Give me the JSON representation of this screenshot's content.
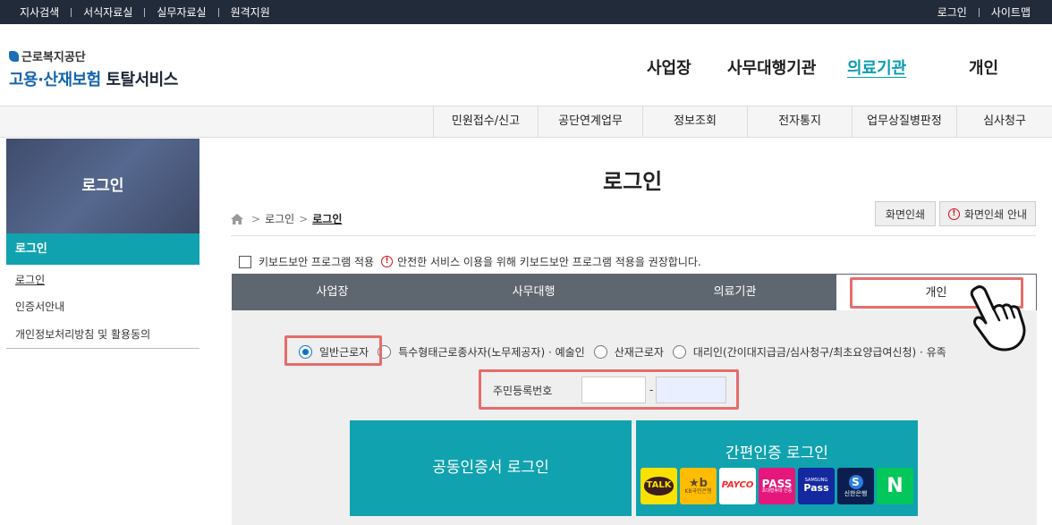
{
  "topbar": {
    "left_links": [
      "지사검색",
      "서식자료실",
      "실무자료실",
      "원격지원"
    ],
    "right_links": [
      "로그인",
      "사이트맵"
    ]
  },
  "logo": {
    "small_text": "근로복지공단",
    "big_blue": "고용·산재보험",
    "big_dark": "토탈서비스"
  },
  "gnb": [
    "사업장",
    "사무대행기관",
    "의료기관",
    "개인"
  ],
  "subnav": [
    "민원접수/신고",
    "공단연계업무",
    "정보조회",
    "전자통지",
    "업무상질병판정",
    "심사청구"
  ],
  "sidebar": {
    "title": "로그인",
    "section": "로그인",
    "items": [
      "로그인",
      "인증서안내",
      "개인정보처리방침 및 활용동의"
    ]
  },
  "content": {
    "title": "로그인",
    "breadcrumb": [
      "로그인",
      "로그인"
    ],
    "print_label": "화면인쇄",
    "print_guide_label": "화면인쇄 안내",
    "keyboard_security_label": "키보드보안 프로그램 적용",
    "keyboard_security_notice": "안전한 서비스 이용을 위해 키보드보안 프로그램 적용을 권장합니다.",
    "warn_glyph": "!"
  },
  "tabs": [
    "사업장",
    "사무대행",
    "의료기관",
    "개인"
  ],
  "radios": [
    "일반근로자",
    "특수형태근로종사자(노무제공자) · 예술인",
    "산재근로자",
    "대리인(간이대지급금/심사청구/최초요양급여신청) · 유족"
  ],
  "rrn": {
    "label": "주민등록번호",
    "dash": "-",
    "value1": "",
    "value2": ""
  },
  "login": {
    "cert_label": "공동인증서 로그인",
    "simple_label": "간편인증 로그인"
  },
  "providers": [
    {
      "name": "kakao",
      "line1": "TALK",
      "line2": "",
      "bg": "#fae100",
      "fg": "#3c1e1e"
    },
    {
      "name": "kb",
      "line1": "★b",
      "line2": "KB국민은행",
      "bg": "#ffbc00",
      "fg": "#5c4a32"
    },
    {
      "name": "payco",
      "line1": "PAYCO",
      "line2": "",
      "bg": "#ffffff",
      "fg": "#fa2828"
    },
    {
      "name": "pass",
      "line1": "PASS",
      "line2": "초대형휴대 인증",
      "bg": "#e5177d",
      "fg": "#ffffff"
    },
    {
      "name": "samsung-pass",
      "line1": "SAMSUNG",
      "line2": "Pass",
      "bg": "#1428a0",
      "fg": "#ffffff"
    },
    {
      "name": "shinhan",
      "line1": "S",
      "line2": "신한은행",
      "bg": "#0a1f4f",
      "fg": "#ffffff"
    },
    {
      "name": "naver",
      "line1": "N",
      "line2": "",
      "bg": "#03c75a",
      "fg": "#ffffff"
    }
  ],
  "colors": {
    "accent": "#10a2ae",
    "highlight": "#e66c6c",
    "topbar": "#222b3a",
    "tabbar": "#5e6670"
  }
}
